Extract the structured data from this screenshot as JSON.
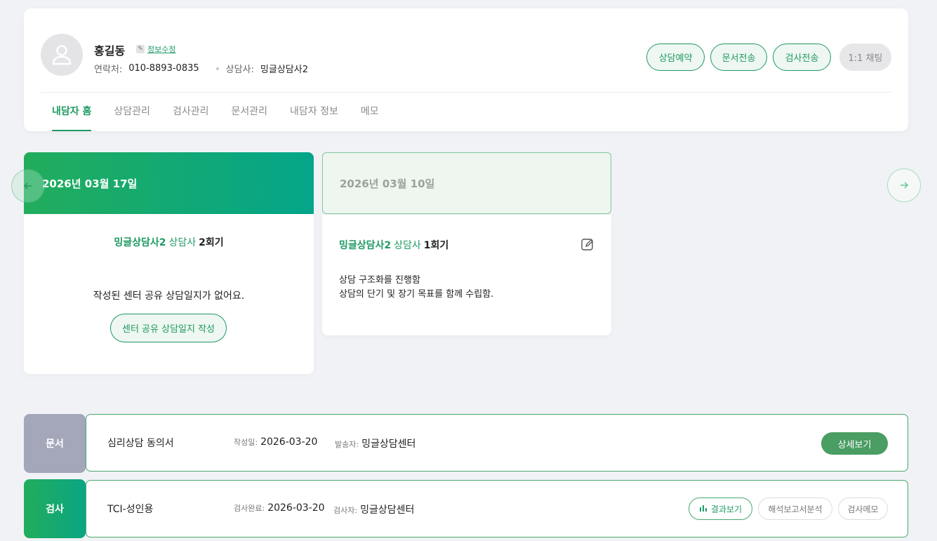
{
  "profile": {
    "name": "홍길동",
    "edit_label": "정보수정",
    "contact_label": "연락처:",
    "contact_value": "010-8893-0835",
    "counselor_label": "상담사:",
    "counselor_value": "밍글상담사2"
  },
  "header_buttons": {
    "reserve": "상담예약",
    "send_document": "문서전송",
    "send_test": "검사전송",
    "chat": "1:1 채팅"
  },
  "tabs": [
    "내담자 홈",
    "상담관리",
    "검사관리",
    "문서관리",
    "내담자 정보",
    "메모"
  ],
  "active_tab": 0,
  "sessions": [
    {
      "date": "2026년 03월 17일",
      "counselor": "밍글상담사2",
      "role": "상담사",
      "session": "2회기",
      "empty_message": "작성된 센터 공유 상담일지가 없어요.",
      "write_button": "센터 공유 상담일지 작성"
    },
    {
      "date": "2026년 03월 10일",
      "counselor": "밍글상담사2",
      "role": "상담사",
      "session": "1회기",
      "notes": [
        "상담 구조화를 진행함",
        "상담의 단기 및 장기 목표를 함께 수립함."
      ]
    }
  ],
  "document_row": {
    "tag": "문서",
    "title": "심리상담 동의서",
    "date_label": "작성일:",
    "date_value": "2026-03-20",
    "sender_label": "발송자:",
    "sender_value": "밍글상담센터",
    "detail_button": "상세보기"
  },
  "test_row": {
    "tag": "검사",
    "title": "TCI-성인용",
    "date_label": "검사완료:",
    "date_value": "2026-03-20",
    "tester_label": "검사자:",
    "tester_value": "밍글상담센터",
    "result_button": "결과보기",
    "report_button": "해석보고서분석",
    "memo_button": "검사메모"
  },
  "icons": {
    "avatar": "user-avatar-icon",
    "edit": "pencil-icon",
    "prev": "arrow-left-icon",
    "next": "arrow-right-icon",
    "note_edit": "edit-note-icon",
    "result": "bar-chart-icon"
  },
  "colors": {
    "accent": "#1f9a63",
    "document_tag": "#a4a6ba"
  }
}
